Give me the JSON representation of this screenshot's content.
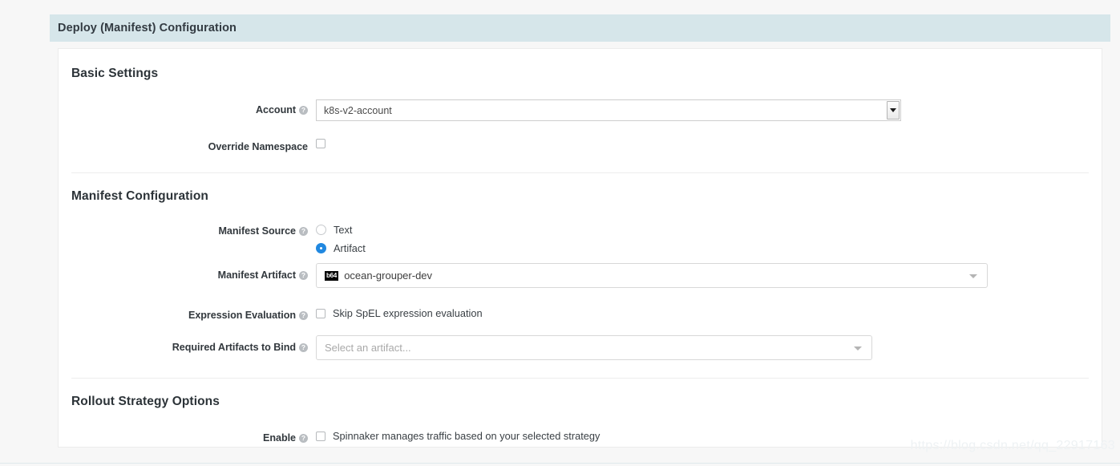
{
  "header": {
    "title": "Deploy (Manifest) Configuration",
    "background_color": "#d6e6ea"
  },
  "sections": {
    "basic": {
      "title": "Basic Settings",
      "account": {
        "label": "Account",
        "help": "?",
        "value": "k8s-v2-account",
        "caret_icon": "chevron-down-icon"
      },
      "override_namespace": {
        "label": "Override Namespace",
        "checked": false
      }
    },
    "manifest": {
      "title": "Manifest Configuration",
      "manifest_source": {
        "label": "Manifest Source",
        "help": "?",
        "options": [
          "Text",
          "Artifact"
        ],
        "selected": "Artifact"
      },
      "manifest_artifact": {
        "label": "Manifest Artifact",
        "help": "?",
        "badge": "b64",
        "value": "ocean-grouper-dev",
        "caret_icon": "chevron-down-icon"
      },
      "expression_evaluation": {
        "label": "Expression Evaluation",
        "help": "?",
        "checkbox_label": "Skip SpEL expression evaluation",
        "checked": false
      },
      "required_artifacts": {
        "label": "Required Artifacts to Bind",
        "help": "?",
        "placeholder": "Select an artifact...",
        "caret_icon": "chevron-down-icon"
      }
    },
    "rollout": {
      "title": "Rollout Strategy Options",
      "enable": {
        "label": "Enable",
        "help": "?",
        "checkbox_label": "Spinnaker manages traffic based on your selected strategy",
        "checked": false
      }
    }
  },
  "watermark": {
    "text": "https://blog.csdn.net/qq_22917163"
  },
  "colors": {
    "accent": "#2188e0",
    "header_bg": "#d6e6ea",
    "page_bg": "#f7f7f7"
  }
}
